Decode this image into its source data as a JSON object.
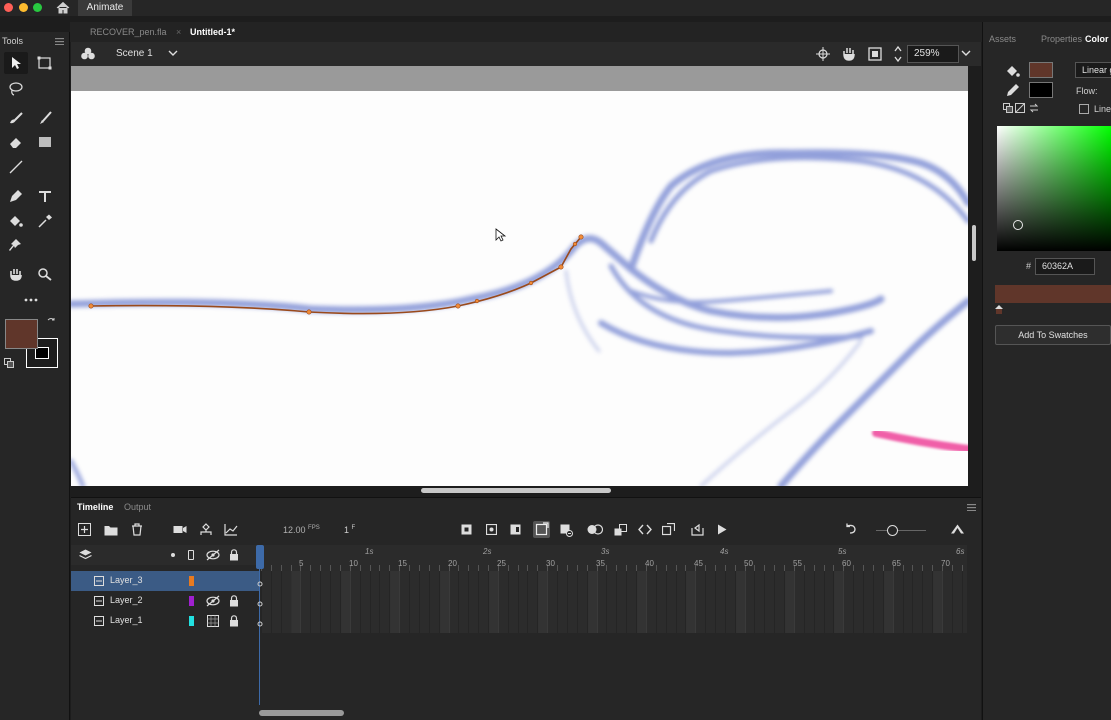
{
  "app": {
    "name": "Animate"
  },
  "document_tabs": [
    {
      "label": "RECOVER_pen.fla",
      "active": false
    },
    {
      "label": "Untitled-1*",
      "active": true
    }
  ],
  "tools_panel": {
    "title": "Tools"
  },
  "scene_bar": {
    "scene_label": "Scene 1",
    "zoom": "259%"
  },
  "right_panel": {
    "tabs": [
      "Assets",
      "Properties",
      "Color"
    ],
    "active_tab": "Color",
    "fill_type": "Linear g",
    "flow_label": "Flow:",
    "linear_rgb_label": "Line",
    "hex_prefix": "#",
    "hex_value": "60362A",
    "add_swatches_label": "Add To Swatches",
    "colors": {
      "fill": "#60362A",
      "stroke": "#000000"
    }
  },
  "timeline": {
    "tabs": [
      "Timeline",
      "Output"
    ],
    "active_tab": "Timeline",
    "fps": "12.00",
    "fps_unit": "FPS",
    "current_frame": "1",
    "frame_unit": "F",
    "second_markers": [
      "1s",
      "2s",
      "3s",
      "4s",
      "5s",
      "6s"
    ],
    "frame_numbers": [
      "5",
      "10",
      "15",
      "20",
      "25",
      "30",
      "35",
      "40",
      "45",
      "50",
      "55",
      "60",
      "65",
      "70"
    ],
    "layers": [
      {
        "name": "Layer_3",
        "color": "#e87a1f",
        "selected": true
      },
      {
        "name": "Layer_2",
        "color": "#a020d0",
        "selected": false
      },
      {
        "name": "Layer_1",
        "color": "#22e0e0",
        "selected": false
      }
    ]
  }
}
